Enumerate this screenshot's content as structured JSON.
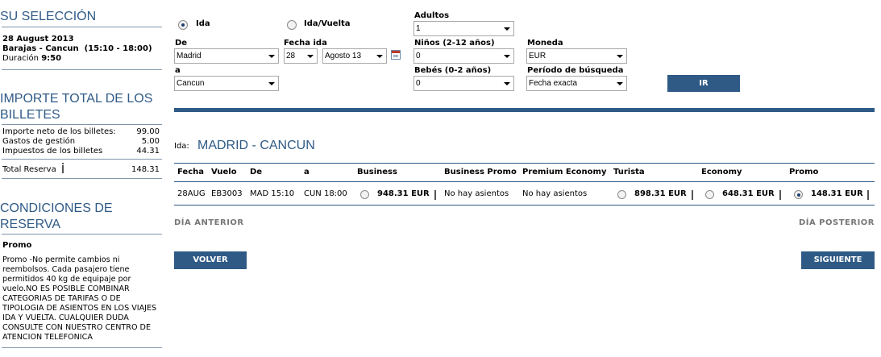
{
  "sidebar": {
    "selection_title": "SU SELECCIÓN",
    "date": "28 August 2013",
    "route": "Barajas - Cancun  (15:10 - 18:00)",
    "duration_label": "Duración",
    "duration_value": "9:50",
    "totals_title_1": "IMPORTE TOTAL DE LOS",
    "totals_title_2": "BILLETES",
    "totals": [
      {
        "label": "Importe neto de los billetes:",
        "value": "99.00"
      },
      {
        "label": "Gastos de gestión",
        "value": "5.00"
      },
      {
        "label": "Impuestos de los billetes",
        "value": "44.31"
      }
    ],
    "total_label": "Total Reserva",
    "total_value": "148.31",
    "conditions_title_1": "CONDICIONES DE",
    "conditions_title_2": "RESERVA",
    "conditions_subtitle": "Promo",
    "conditions_text": "Promo -No permite cambios ni reembolsos. Cada pasajero tiene permitidos 40 kg de equipaje por vuelo.NO ES POSIBLE COMBINAR CATEGORIAS DE TARIFAS O DE TIPOLOGIA DE ASIENTOS EN LOS VIAJES IDA Y VUELTA. CUALQUIER DUDA CONSULTE CON NUESTRO CENTRO DE ATENCION TELEFONICA"
  },
  "search": {
    "trip_oneway": "Ida",
    "trip_return": "Ida/Vuelta",
    "from_label": "De",
    "from_value": "Madrid",
    "to_label": "a",
    "to_value": "Cancun",
    "date_label": "Fecha ida",
    "day_value": "28",
    "month_value": "Agosto 13",
    "adults_label": "Adultos",
    "adults_value": "1",
    "children_label": "Niños (2-12 años)",
    "children_value": "0",
    "infants_label": "Bebés (0-2 años)",
    "infants_value": "0",
    "currency_label": "Moneda",
    "currency_value": "EUR",
    "period_label": "Período de búsqueda",
    "period_value": "Fecha exacta",
    "go_button": "IR"
  },
  "results": {
    "leg_label": "Ida:",
    "route_title": "MADRID - CANCUN",
    "headers": {
      "date": "Fecha",
      "flight": "Vuelo",
      "from": "De",
      "to": "a",
      "business": "Business",
      "business_promo": "Business Promo",
      "premium": "Premium Economy",
      "tourist": "Turista",
      "economy": "Economy",
      "promo": "Promo"
    },
    "row": {
      "date": "28AUG",
      "flight": "EB3003",
      "dep": "MAD 15:10",
      "arr": "CUN 18:00",
      "business": "948.31 EUR",
      "business_promo": "No hay asientos",
      "premium": "No hay asientos",
      "tourist": "898.31 EUR",
      "economy": "648.31 EUR",
      "promo": "148.31 EUR"
    },
    "prev_day": "DÍA ANTERIOR",
    "next_day": "DÍA POSTERIOR",
    "back_button": "VOLVER",
    "next_button": "SIGUIENTE"
  }
}
